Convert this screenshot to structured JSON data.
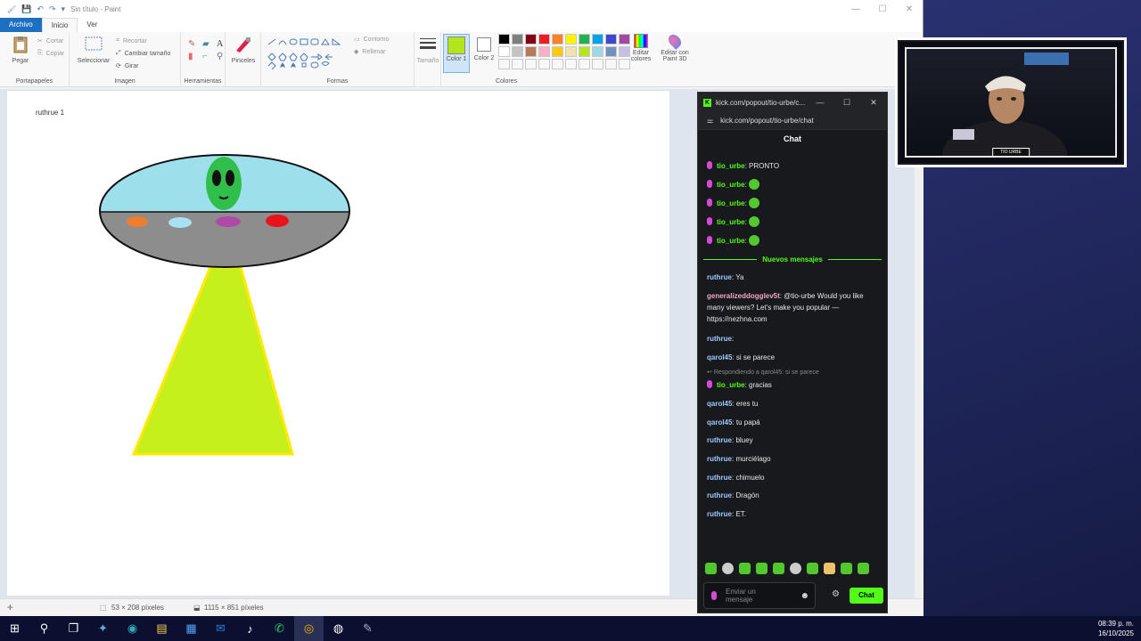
{
  "paint": {
    "title": "Sin título - Paint",
    "menu": {
      "file": "Archivo",
      "home": "Inicio",
      "view": "Ver"
    },
    "groups": {
      "clipboard": "Portapapeles",
      "image": "Imagen",
      "tools": "Herramientas",
      "shapes": "Formas",
      "colors": "Colores"
    },
    "buttons": {
      "paste": "Pegar",
      "cut": "Cortar",
      "copy": "Copiar",
      "select": "Seleccionar",
      "crop": "Recortar",
      "resize": "Cambiar tamaño",
      "rotate": "Girar",
      "brushes": "Pinceles",
      "outline": "Contorno",
      "fill": "Rellenar",
      "size": "Tamaño",
      "color1": "Color 1",
      "color2": "Color 2",
      "edit_colors": "Editar colores",
      "paint3d": "Editar con Paint 3D"
    },
    "palette": [
      "#000000",
      "#7f7f7f",
      "#880015",
      "#ed1c24",
      "#ff7f27",
      "#fff200",
      "#22b14c",
      "#00a2e8",
      "#3f48cc",
      "#a349a4",
      "#ffffff",
      "#c3c3c3",
      "#b97a57",
      "#ffaec9",
      "#ffc90e",
      "#efe4b0",
      "#b5e61d",
      "#99d9ea",
      "#7092be",
      "#c8bfe7"
    ],
    "current_color1": "#b5e61d",
    "canvas_caption": "ruthrue 1",
    "status": {
      "selection": "53 × 208 píxeles",
      "canvas_size": "1115 × 851 píxeles"
    }
  },
  "chat": {
    "window_title": "kick.com/popout/tio-urbe/c...",
    "url": "kick.com/popout/tio-urbe/chat",
    "heading": "Chat",
    "new_messages": "Nuevos mensajes",
    "messages_before": [
      {
        "user": "tio_urbe",
        "text": ": PRONTO",
        "color": "#53fc18",
        "mic": true
      },
      {
        "user": "tio_urbe",
        "text": ":",
        "color": "#53fc18",
        "mic": true,
        "emote": true
      },
      {
        "user": "tio_urbe",
        "text": ":",
        "color": "#53fc18",
        "mic": true,
        "emote": true
      },
      {
        "user": "tio_urbe",
        "text": ":",
        "color": "#53fc18",
        "mic": true,
        "emote": true
      },
      {
        "user": "tio_urbe",
        "text": ":",
        "color": "#53fc18",
        "mic": true,
        "emote": true
      }
    ],
    "messages_after": [
      {
        "user": "ruthrue",
        "text": ": Ya",
        "color": "#9ec9ff"
      },
      {
        "user": "generalizeddogglev5t",
        "text": ": @tio-urbe Would you like many viewers? Let's make you popular — https://nezhna.com",
        "color": "#f2a7c3"
      },
      {
        "user": "ruthrue",
        "text": ":",
        "color": "#9ec9ff"
      },
      {
        "user": "qarol45",
        "text": ": si se parece",
        "color": "#9ec9ff"
      },
      {
        "user": "tio_urbe",
        "text": ": gracias",
        "color": "#53fc18",
        "mic": true
      },
      {
        "user": "qarol45",
        "text": ": eres tu",
        "color": "#9ec9ff"
      },
      {
        "user": "qarol45",
        "text": ": tu papá",
        "color": "#9ec9ff"
      },
      {
        "user": "ruthrue",
        "text": ": bluey",
        "color": "#9ec9ff"
      },
      {
        "user": "ruthrue",
        "text": ": murciélago",
        "color": "#9ec9ff"
      },
      {
        "user": "ruthrue",
        "text": ": chimuelo",
        "color": "#9ec9ff"
      },
      {
        "user": "ruthrue",
        "text": ": Dragón",
        "color": "#9ec9ff"
      },
      {
        "user": "ruthrue",
        "text": ": ET.",
        "color": "#9ec9ff"
      }
    ],
    "reply_note": "Respondiendo a qarol45: si se parece",
    "input_placeholder": "Enviar un mensaje",
    "send_label": "Chat"
  },
  "webcam": {
    "tag": "TIO URBE"
  },
  "taskbar": {
    "time": "08:39 p. m.",
    "date": "16/10/2025"
  }
}
